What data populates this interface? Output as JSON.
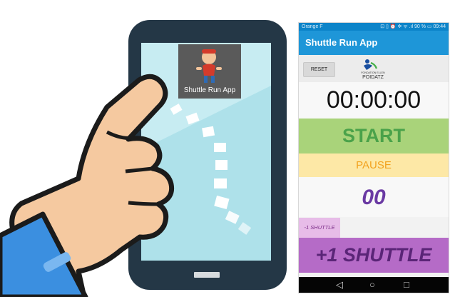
{
  "illustration": {
    "app_icon_label": "Shuttle Run App"
  },
  "status_bar": {
    "carrier": "Orange F",
    "indicators": "⊡ ▯ ⏰ ✲ ᯤ .ıl 90 % ▭ 09:44"
  },
  "app": {
    "title": "Shuttle Run App",
    "reset_label": "RESET",
    "logo_text_line1": "FONDATION ELLEN",
    "logo_text_line2": "POIDATZ",
    "timer": "00:00:00",
    "start_label": "START",
    "pause_label": "PAUSE",
    "count": "00",
    "minus_label": "-1 SHUTTLE",
    "plus_label": "+1 SHUTTLE"
  },
  "nav": {
    "back": "◁",
    "home": "○",
    "recent": "□"
  },
  "colors": {
    "phone_body": "#243746",
    "screen": "#aee1ea",
    "hand": "#f5c9a0",
    "sleeve": "#3b8fe0",
    "app_bar": "#1e96d8",
    "start_bg": "#a9d37a",
    "pause_bg": "#fde8a6",
    "plus_bg": "#b56bc7"
  }
}
